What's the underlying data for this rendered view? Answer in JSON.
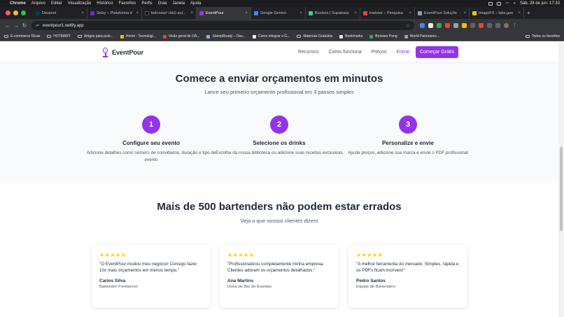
{
  "os_menu": {
    "app": "Chrome",
    "items": [
      "Arquivo",
      "Editar",
      "Visualização",
      "Histórico",
      "Favoritos",
      "Perfis",
      "Guia",
      "Janela",
      "Ajuda"
    ],
    "datetime": "Sáb. 28 de jun.  17:33"
  },
  "tabs": [
    {
      "label": "Devpost",
      "color": "#003e54"
    },
    {
      "label": "Selzy – Plataforma d",
      "color": "#6d28d9"
    },
    {
      "label": "bolt.new/~/sb1-aut...",
      "color": "#111111"
    },
    {
      "label": "EventPour",
      "color": "#9333ea",
      "active": true
    },
    {
      "label": "Google Gemini",
      "color": "#4285f4"
    },
    {
      "label": "Buckets | Supabase",
      "color": "#3ecf8e"
    },
    {
      "label": "tradutor – Pesquisa",
      "color": "#ea4335"
    },
    {
      "label": "EventPour Soluçõe",
      "color": "#9aa0a6"
    },
    {
      "label": "ImageFX – labs.goo",
      "color": "#fbbc04"
    }
  ],
  "address_bar": {
    "url": "eventpour1.netlify.app"
  },
  "bookmarks": {
    "items": [
      {
        "label": "E-commerce Dicas",
        "type": "folder"
      },
      {
        "label": "HOTMART",
        "type": "folder"
      },
      {
        "label": "Artigos para post...",
        "type": "folder"
      },
      {
        "label": "Home - Tecnologi...",
        "type": "link"
      },
      {
        "label": "Visão geral de OA...",
        "type": "link"
      },
      {
        "label": "StampReady – Das...",
        "type": "link"
      },
      {
        "label": "Como integrar o G...",
        "type": "link"
      },
      {
        "label": "Materiais Gratuitos",
        "type": "folder"
      },
      {
        "label": "Bookmarks",
        "type": "link"
      },
      {
        "label": "Browser Pong",
        "type": "link"
      },
      {
        "label": "World Panoramic...",
        "type": "link"
      }
    ],
    "all_label": "Todos os favoritos"
  },
  "site": {
    "brand": "EventPour",
    "nav": {
      "links": [
        "Recursos",
        "Como funciona",
        "Preços",
        "Entrar"
      ],
      "cta": "Começar Grátis"
    },
    "steps": {
      "title": "Comece a enviar orçamentos em minutos",
      "subtitle": "Lance seu primeiro orçamento profissional em 3 passos simples",
      "items": [
        {
          "num": "1",
          "title": "Configure seu evento",
          "desc": "Adicione detalhes como número de convidados, duração e tipo de evento"
        },
        {
          "num": "2",
          "title": "Selecione os drinks",
          "desc": "Escolha da nossa biblioteca ou adicione suas receitas exclusivas"
        },
        {
          "num": "3",
          "title": "Personalize e envie",
          "desc": "Ajuste preços, adicione sua marca e envie o PDF profissional"
        }
      ]
    },
    "testimonials": {
      "title": "Mais de 500 bartenders não podem estar errados",
      "subtitle": "Veja o que nossos clientes dizem",
      "items": [
        {
          "stars": "★★★★★",
          "quote": "\"O EventPour mudou meu negócio! Consigo fazer 10x mais orçamentos em menos tempo.\"",
          "name": "Carlos Silva",
          "role": "Bartender Freelancer"
        },
        {
          "stars": "★★★★★",
          "quote": "\"Profissionalizou completamente minha empresa. Clientes adoram os orçamentos detalhados.\"",
          "name": "Ana Martins",
          "role": "Dona de Bar de Eventos"
        },
        {
          "stars": "★★★★★",
          "quote": "\"A melhor ferramenta do mercado. Simples, rápida e os PDFs ficam incríveis!\"",
          "name": "Pedro Santos",
          "role": "Equipe de Bartenders"
        }
      ]
    }
  },
  "colors": {
    "accent": "#9333ea",
    "star": "#facc15",
    "section_bg": "#f9fafb"
  }
}
